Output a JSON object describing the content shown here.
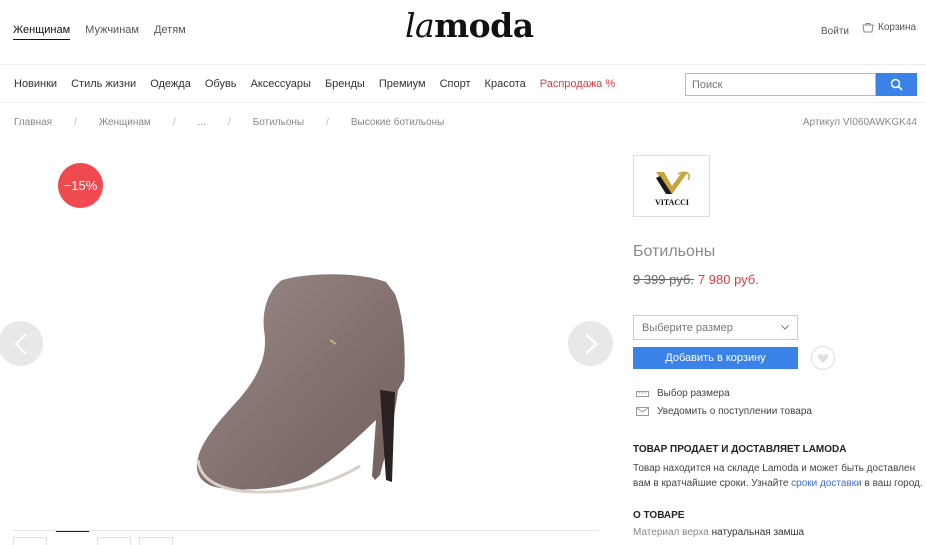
{
  "header": {
    "gender_tabs": [
      "Женщинам",
      "Мужчинам",
      "Детям"
    ],
    "logo_la": "la",
    "logo_moda": "moda",
    "login": "Войти",
    "cart": "Корзина"
  },
  "nav": {
    "items": [
      "Новинки",
      "Стиль жизни",
      "Одежда",
      "Обувь",
      "Аксессуары",
      "Бренды",
      "Премиум",
      "Спорт",
      "Красота"
    ],
    "sale": "Распродажа %",
    "search_placeholder": "Поиск"
  },
  "breadcrumb": [
    "Главная",
    "Женщинам",
    "...",
    "Ботильоны",
    "Высокие ботильоны"
  ],
  "article": "Артикул VI060AWKGK44",
  "gallery": {
    "discount": "−15%"
  },
  "product": {
    "brand_logo_text": "VITACCI",
    "title": "Ботильоны",
    "old_price": "9 399 руб.",
    "new_price": "7 980 руб.",
    "size_placeholder": "Выберите размер",
    "add_to_cart": "Добавить в корзину",
    "size_guide": "Выбор размера",
    "notify": "Уведомить о поступлении товара",
    "seller_heading": "ТОВАР ПРОДАЕТ И ДОСТАВЛЯЕТ LAMODA",
    "seller_text_1": "Товар находится на складе Lamoda и может быть доставлен вам в кратчайшие сроки. Узнайте ",
    "seller_link": "сроки доставки",
    "seller_text_2": " в ваш город.",
    "about_heading": "О ТОВАРЕ",
    "material_label": "Материал верха",
    "material_value": "натуральная замша"
  },
  "colors": {
    "accent": "#3b82e8",
    "sale": "#e23c3c",
    "badge": "#ef4a50"
  }
}
